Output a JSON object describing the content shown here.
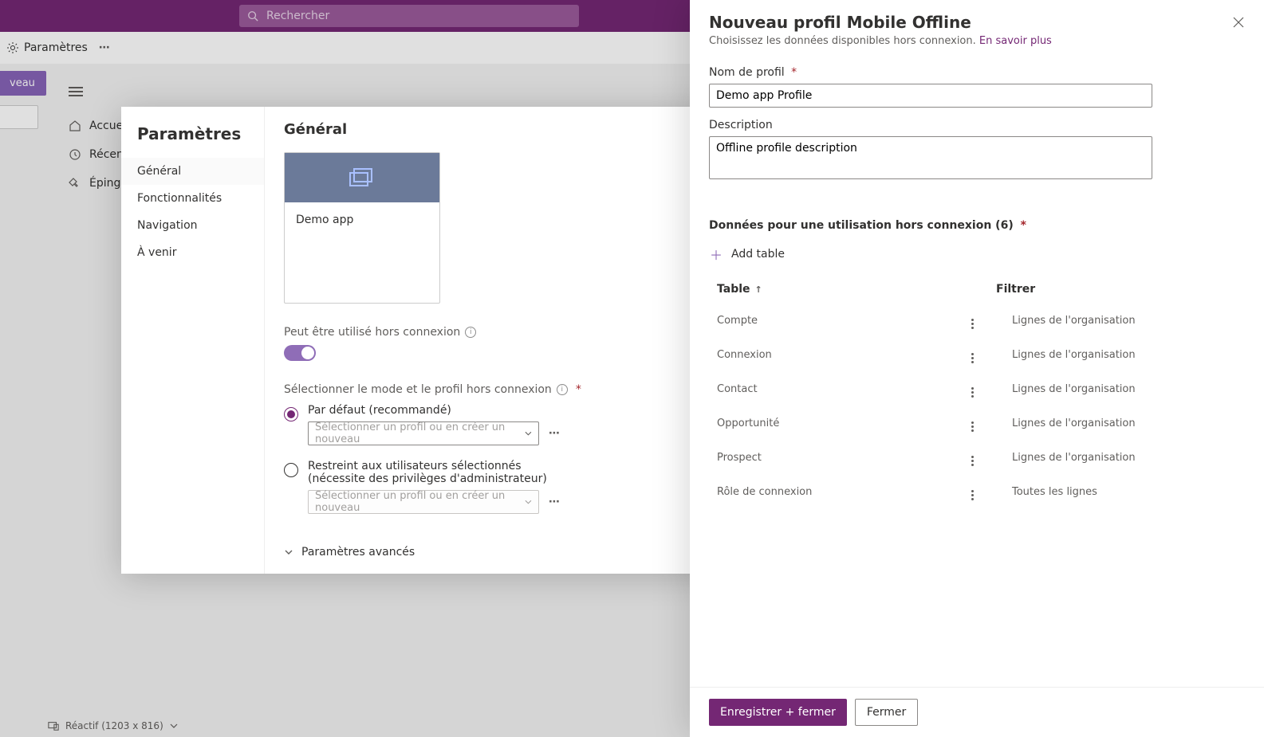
{
  "topbar": {
    "search_placeholder": "Rechercher"
  },
  "cmdbar": {
    "settings_label": "Paramètres"
  },
  "newchip": {
    "label": "veau"
  },
  "rail": {
    "items": [
      {
        "label": "Accue"
      },
      {
        "label": "Récen"
      },
      {
        "label": "Éping"
      }
    ]
  },
  "settings": {
    "title": "Paramètres",
    "nav": [
      "Général",
      "Fonctionnalités",
      "Navigation",
      "À venir"
    ],
    "active_nav_index": 0,
    "general": {
      "title": "Général",
      "app_name": "Demo app",
      "offline_label": "Peut être utilisé hors connexion",
      "select_mode_label": "Sélectionner le mode et le profil hors connexion",
      "radio1_label": "Par défaut (recommandé)",
      "radio2_label": "Restreint aux utilisateurs sélectionnés (nécessite des privilèges d'administrateur)",
      "select_placeholder": "Sélectionner un profil ou en créer un nouveau",
      "advanced_label": "Paramètres avancés"
    }
  },
  "panel": {
    "title": "Nouveau profil Mobile Offline",
    "subtitle": "Choisissez les données disponibles hors connexion.",
    "learn_more": "En savoir plus",
    "profile_name_label": "Nom de profil",
    "profile_name_value": "Demo app Profile",
    "description_label": "Description",
    "description_value": "Offline profile description",
    "data_section_label": "Données pour une utilisation hors connexion (6)",
    "add_table_label": "Add table",
    "col_table": "Table",
    "col_filter": "Filtrer",
    "rows": [
      {
        "table": "Compte",
        "filter": "Lignes de l'organisation"
      },
      {
        "table": "Connexion",
        "filter": "Lignes de l'organisation"
      },
      {
        "table": "Contact",
        "filter": "Lignes de l'organisation"
      },
      {
        "table": "Opportunité",
        "filter": "Lignes de l'organisation"
      },
      {
        "table": "Prospect",
        "filter": "Lignes de l'organisation"
      },
      {
        "table": "Rôle de connexion",
        "filter": "Toutes les lignes"
      }
    ],
    "save_close": "Enregistrer + fermer",
    "close": "Fermer"
  },
  "statusbar": {
    "label": "Réactif (1203 x 816)"
  }
}
